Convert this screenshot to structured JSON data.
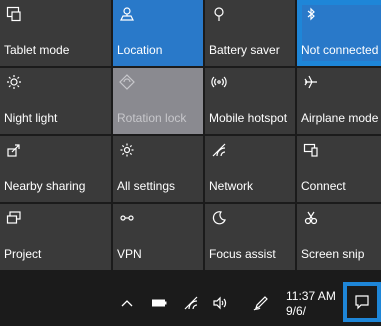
{
  "tiles": [
    {
      "label": "Tablet mode",
      "icon": "tablet-mode-icon",
      "state": "off"
    },
    {
      "label": "Location",
      "icon": "location-icon",
      "state": "on"
    },
    {
      "label": "Battery saver",
      "icon": "battery-saver-icon",
      "state": "off"
    },
    {
      "label": "Not connected",
      "icon": "bluetooth-icon",
      "state": "on"
    },
    {
      "label": "Night light",
      "icon": "night-light-icon",
      "state": "off"
    },
    {
      "label": "Rotation lock",
      "icon": "rotation-lock-icon",
      "state": "disabled"
    },
    {
      "label": "Mobile hotspot",
      "icon": "mobile-hotspot-icon",
      "state": "off"
    },
    {
      "label": "Airplane mode",
      "icon": "airplane-mode-icon",
      "state": "off"
    },
    {
      "label": "Nearby sharing",
      "icon": "nearby-sharing-icon",
      "state": "off"
    },
    {
      "label": "All settings",
      "icon": "gear-icon",
      "state": "off"
    },
    {
      "label": "Network",
      "icon": "network-icon",
      "state": "off"
    },
    {
      "label": "Connect",
      "icon": "connect-icon",
      "state": "off"
    },
    {
      "label": "Project",
      "icon": "project-icon",
      "state": "off"
    },
    {
      "label": "VPN",
      "icon": "vpn-icon",
      "state": "off"
    },
    {
      "label": "Focus assist",
      "icon": "focus-assist-icon",
      "state": "off"
    },
    {
      "label": "Screen snip",
      "icon": "screen-snip-icon",
      "state": "off"
    }
  ],
  "taskbar": {
    "time": "11:37 AM",
    "date": "9/6/",
    "tray_icons": [
      "chevron-up-icon",
      "battery-icon",
      "wifi-icon",
      "volume-icon",
      "pen-icon"
    ]
  },
  "colors": {
    "tile_off": "#3a3a3a",
    "tile_on": "#2979c9",
    "tile_disabled": "#8a8a90",
    "highlight": "#1e86d8",
    "background": "#1b1b1b"
  }
}
